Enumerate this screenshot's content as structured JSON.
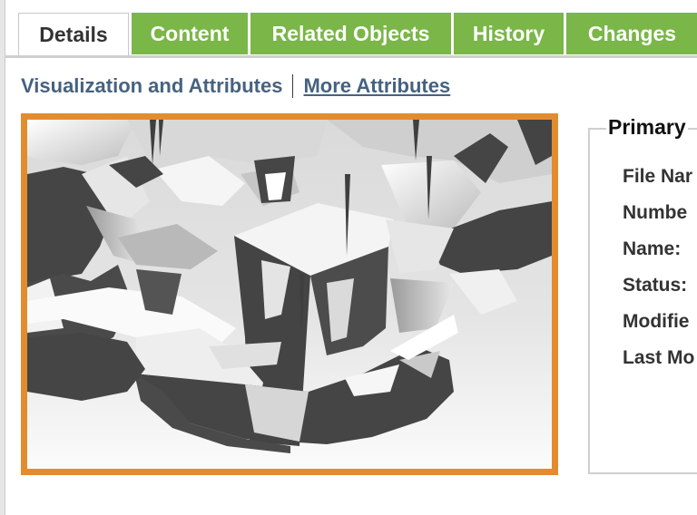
{
  "tabs": [
    {
      "label": "Details",
      "active": true
    },
    {
      "label": "Content",
      "active": false
    },
    {
      "label": "Related Objects",
      "active": false
    },
    {
      "label": "History",
      "active": false
    },
    {
      "label": "Changes",
      "active": false
    }
  ],
  "subnav": {
    "visualization_label": "Visualization and Attributes",
    "more_label": "More Attributes"
  },
  "viewer": {
    "border_color": "#e28c2f"
  },
  "primary_panel": {
    "title": "Primary",
    "fields": [
      "File Nar",
      "Numbe",
      "Name:",
      "Status:",
      "Modifie",
      "Last Mo"
    ]
  },
  "colors": {
    "tab_green": "#7ab648",
    "link_blue": "#466281",
    "viewer_border": "#e28c2f",
    "model_dark": "#454545"
  },
  "icons": []
}
